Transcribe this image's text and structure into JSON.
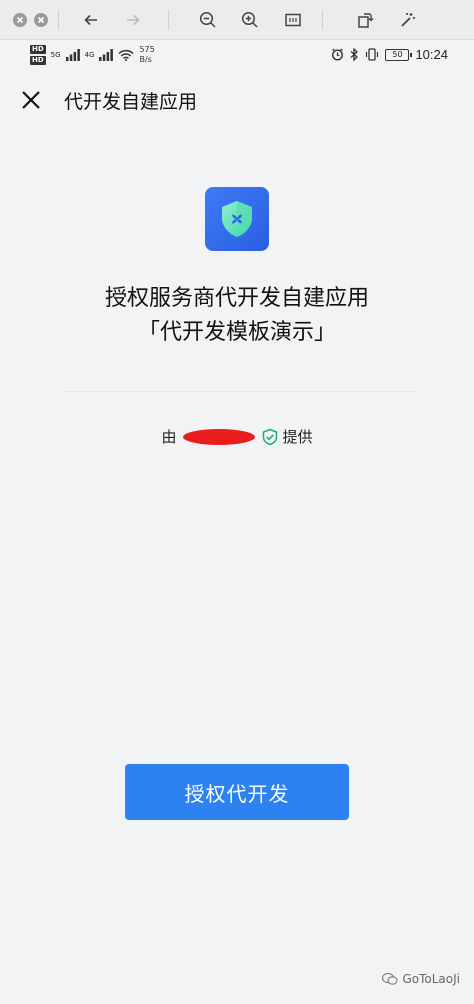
{
  "status": {
    "network_speed": "575",
    "speed_unit": "B/s",
    "hd_labels": [
      "HD",
      "HD"
    ],
    "signal_labels": [
      "5G",
      "4G"
    ],
    "battery": "50",
    "time": "10:24"
  },
  "header": {
    "title": "代开发自建应用"
  },
  "main": {
    "title_line1": "授权服务商代开发自建应用",
    "title_line2": "「代开发模板演示」",
    "provider_prefix": "由",
    "provider_suffix": "提供",
    "action_label": "授权代开发"
  },
  "watermark": {
    "text": "GoToLaoJi"
  },
  "colors": {
    "accent": "#2b82f0",
    "icon_bg": "#3d7bf5",
    "verified": "#19b26b"
  }
}
